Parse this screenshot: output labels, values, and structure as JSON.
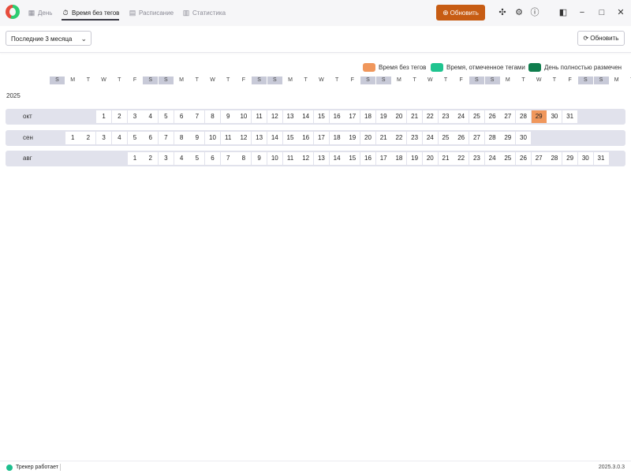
{
  "titlebar": {
    "tabs": [
      {
        "label": "День",
        "icon": "calendar-icon"
      },
      {
        "label": "Время без тегов",
        "icon": "timer-icon"
      },
      {
        "label": "Расписание",
        "icon": "document-icon"
      },
      {
        "label": "Статистика",
        "icon": "chart-icon"
      }
    ],
    "active_tab": 1,
    "refresh_label": "Обновить",
    "accent_color": "#c75c13"
  },
  "toolbar": {
    "range_value": "Последние 3 месяца",
    "refresh_label": "Обновить"
  },
  "legend": [
    {
      "label": "Время без тегов",
      "color": "#f0975c"
    },
    {
      "label": "Время, отмеченное тегами",
      "color": "#1fc48f"
    },
    {
      "label": "День полностью размечен",
      "color": "#0f7d4d"
    }
  ],
  "weekday_header": [
    "S",
    "M",
    "T",
    "W",
    "T",
    "F",
    "S",
    "S",
    "M",
    "T",
    "W",
    "T",
    "F",
    "S",
    "S",
    "M",
    "T",
    "W",
    "T",
    "F",
    "S",
    "S",
    "M",
    "T",
    "W",
    "T",
    "F",
    "S",
    "S",
    "M",
    "T",
    "W",
    "T",
    "F",
    "S",
    "S",
    "M",
    "T"
  ],
  "year": "2025",
  "months": [
    {
      "label": "окт",
      "first_column": 3,
      "days": 31,
      "highlighted_day": 29
    },
    {
      "label": "сен",
      "first_column": 1,
      "days": 30,
      "highlighted_day": null
    },
    {
      "label": "авг",
      "first_column": 5,
      "days": 31,
      "highlighted_day": null
    }
  ],
  "status": {
    "text": "Трекер работает",
    "version": "2025.3.0.3",
    "dot_color": "#1fbf8f"
  }
}
